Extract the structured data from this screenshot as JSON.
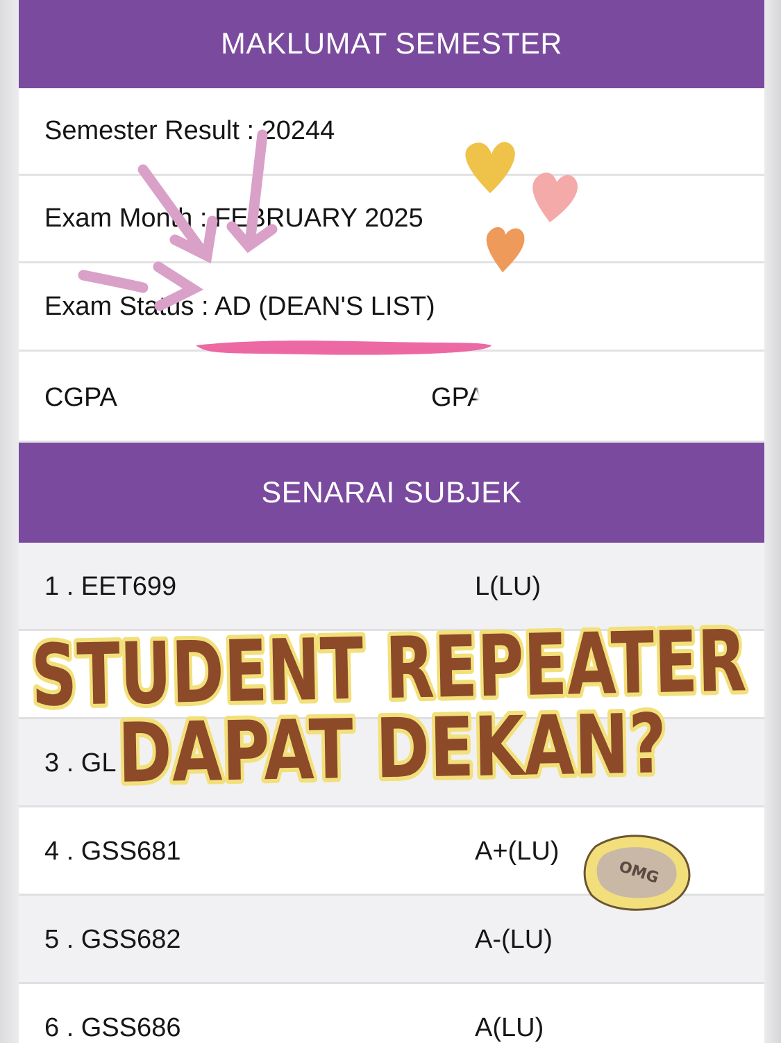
{
  "semester_section": {
    "title": "MAKLUMAT SEMESTER",
    "rows": [
      {
        "label": "Semester Result",
        "sep": " : ",
        "value": "20244"
      },
      {
        "label": "Exam Month",
        "sep": " : ",
        "value": "FEBRUARY 2025"
      },
      {
        "label": "Exam Status",
        "sep": " : ",
        "value": "AD (DEAN'S LIST)"
      }
    ],
    "cgpa_label": "CGPA",
    "gpa_label": "GPA"
  },
  "subject_section": {
    "title": "SENARAI SUBJEK",
    "rows": [
      {
        "code": "1 . EET699",
        "grade": "L(LU)"
      },
      {
        "code": "",
        "grade": ""
      },
      {
        "code": "3 . GL",
        "grade": ""
      },
      {
        "code": "4 . GSS681",
        "grade": "A+(LU)"
      },
      {
        "code": "5 . GSS682",
        "grade": "A-(LU)"
      },
      {
        "code": "6 . GSS686",
        "grade": "A(LU)"
      }
    ]
  },
  "overlay": {
    "headline_line1": "STUDENT  REPEATER",
    "headline_line2": "DAPAT  DEKAN?",
    "sticker_text": "OMG",
    "colors": {
      "headline_fill": "#8c4a28",
      "headline_outline": "#f2e07a",
      "arrow": "#d9a0c8",
      "highlight": "#ec5c9c",
      "heart_yellow": "#efc24a",
      "heart_pink": "#f4aaa8",
      "heart_orange": "#ee9a5a"
    }
  }
}
